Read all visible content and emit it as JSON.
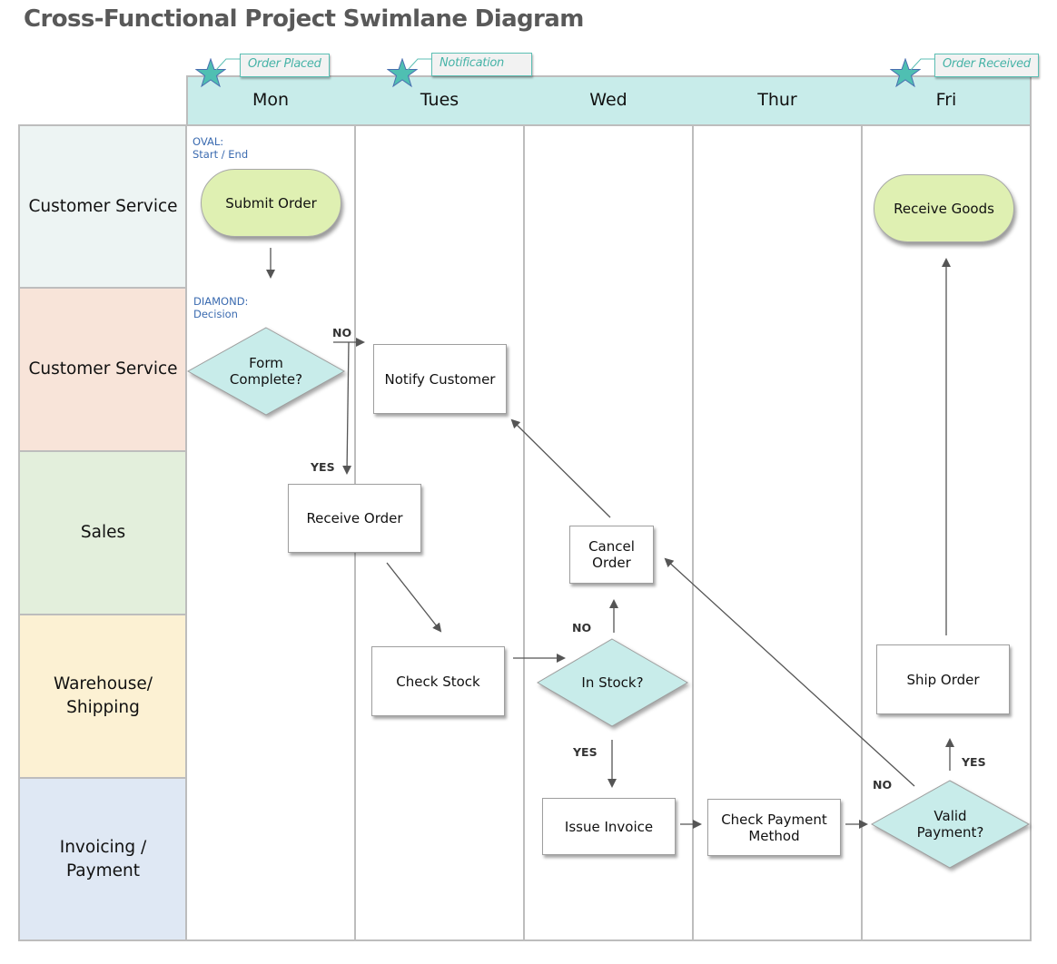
{
  "title": "Cross-Functional Project Swimlane Diagram",
  "days": [
    "Mon",
    "Tues",
    "Wed",
    "Thur",
    "Fri"
  ],
  "lanes": [
    {
      "label": "Customer Service",
      "color": "#edf4f3"
    },
    {
      "label": "Customer Service",
      "color": "#f8e4d9"
    },
    {
      "label": "Sales",
      "color": "#e3efdc"
    },
    {
      "label": "Warehouse/\nShipping",
      "color": "#fcf1d3"
    },
    {
      "label": "Invoicing /\nPayment",
      "color": "#dfe8f4"
    }
  ],
  "milestones": [
    {
      "label": "Order Placed",
      "icon": "star-icon"
    },
    {
      "label": "Notification",
      "icon": "star-icon"
    },
    {
      "label": "Order Received",
      "icon": "star-icon"
    }
  ],
  "legend_notes": {
    "oval": "OVAL:\nStart / End",
    "diamond": "DIAMOND:\nDecision"
  },
  "nodes": {
    "submit_order": "Submit Order",
    "form_complete": "Form\nComplete?",
    "notify_customer": "Notify Customer",
    "receive_order": "Receive Order",
    "check_stock": "Check Stock",
    "in_stock": "In Stock?",
    "cancel_order": "Cancel\nOrder",
    "issue_invoice": "Issue Invoice",
    "check_payment": "Check Payment\nMethod",
    "valid_payment": "Valid\nPayment?",
    "ship_order": "Ship Order",
    "receive_goods": "Receive Goods"
  },
  "flags": {
    "form_no": "NO",
    "form_yes": "YES",
    "stock_no": "NO",
    "stock_yes": "YES",
    "payment_no": "NO",
    "payment_yes": "YES"
  },
  "colors": {
    "header": "#c8ecea",
    "decision": "#c8ecea",
    "terminator": "#dff0b2",
    "star": "#4fbfb2",
    "note_text": "#3b6bb0",
    "grid_line": "#bdbdbd"
  }
}
